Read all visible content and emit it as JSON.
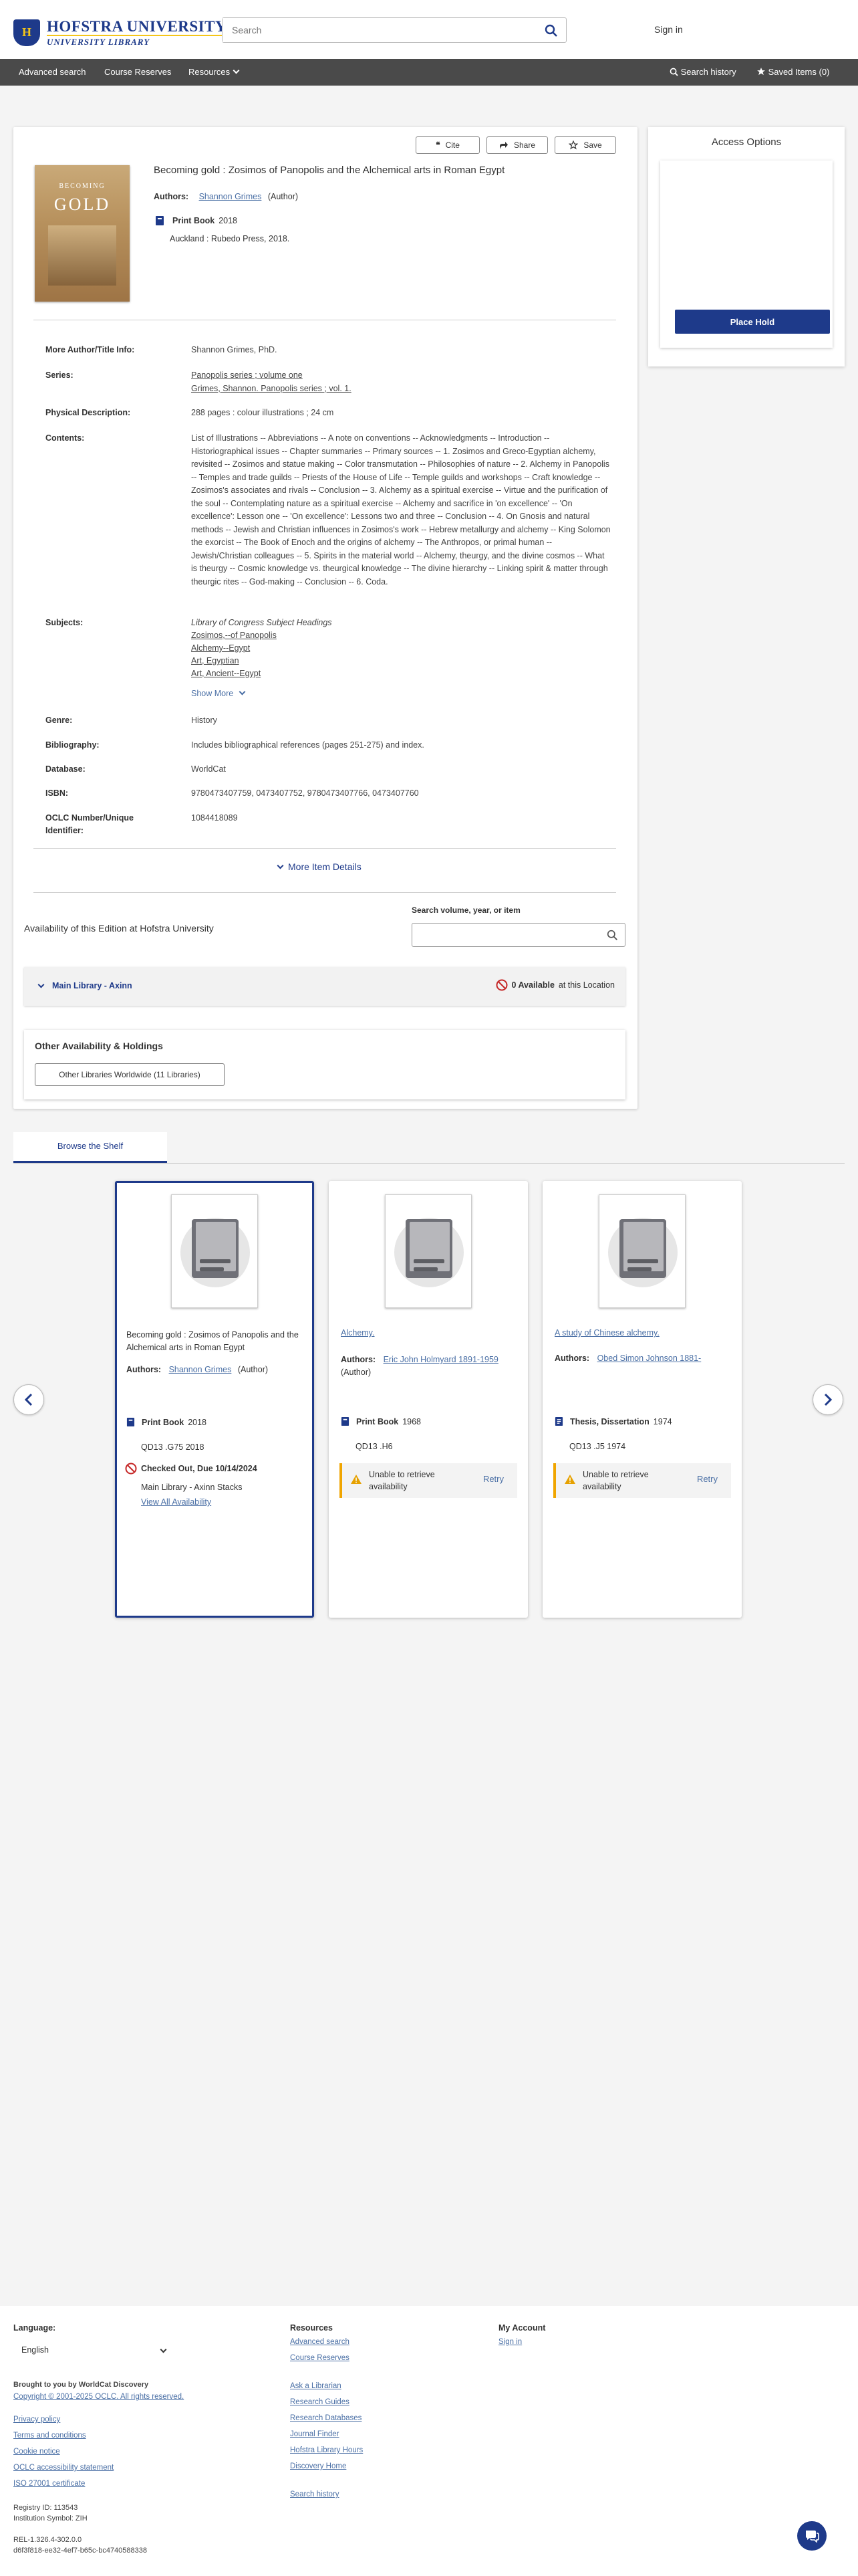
{
  "header": {
    "logo_line1": "HOFSTRA UNIVERSITY.",
    "logo_line2": "UNIVERSITY LIBRARY",
    "search_placeholder": "Search",
    "signin": "Sign in"
  },
  "nav": {
    "advanced_search": "Advanced search",
    "course_reserves": "Course Reserves",
    "resources": "Resources",
    "search_history": "Search history",
    "saved_items": "Saved Items (0)"
  },
  "record": {
    "cite": "Cite",
    "share": "Share",
    "save": "Save",
    "cover_line1": "BECOMING",
    "cover_line2": "GOLD",
    "title": "Becoming gold : Zosimos of Panopolis and the Alchemical arts in Roman Egypt",
    "authors_label": "Authors:",
    "author_name": "Shannon Grimes",
    "author_role": "(Author)",
    "format": "Print Book",
    "year": "2018",
    "publisher": "Auckland : Rubedo Press, 2018."
  },
  "details": {
    "more_author_label": "More Author/Title Info:",
    "more_author_value": "Shannon Grimes, PhD.",
    "series_label": "Series:",
    "series_1": "Panopolis series ; volume one",
    "series_2": "Grimes, Shannon. Panopolis series ; vol. 1.",
    "physical_label": "Physical Description:",
    "physical_value": "288 pages : colour illustrations ; 24 cm",
    "contents_label": "Contents:",
    "contents_value": "List of Illustrations -- Abbreviations -- A note on conventions -- Acknowledgments -- Introduction -- Historiographical issues -- Chapter summaries -- Primary sources -- 1. Zosimos and Greco-Egyptian alchemy, revisited -- Zosimos and statue making -- Color transmutation -- Philosophies of nature -- 2. Alchemy in Panopolis -- Temples and trade guilds -- Priests of the House of Life -- Temple guilds and workshops -- Craft knowledge -- Zosimos's associates and rivals -- Conclusion -- 3. Alchemy as a spiritual exercise -- Virtue and the purification of the soul -- Contemplating nature as a spiritual exercise -- Alchemy and sacrifice in 'on excellence' -- 'On excellence': Lesson one -- 'On excellence': Lessons two and three -- Conclusion -- 4. On Gnosis and natural methods -- Jewish and Christian influences in Zosimos's work -- Hebrew metallurgy and alchemy -- King Solomon the exorcist -- The Book of Enoch and the origins of alchemy -- The Anthropos, or primal human -- Jewish/Christian colleagues -- 5. Spirits in the material world -- Alchemy, theurgy, and the divine cosmos -- What is theurgy -- Cosmic knowledge vs. theurgical knowledge -- The divine hierarchy -- Linking spirit & matter through theurgic rites -- God-making -- Conclusion -- 6. Coda.",
    "subjects_label": "Subjects:",
    "subjects_heading": "Library of Congress Subject Headings",
    "subjects": [
      "Zosimos,--of Panopolis",
      "Alchemy--Egypt",
      "Art, Egyptian",
      "Art, Ancient--Egypt"
    ],
    "show_more": "Show More",
    "genre_label": "Genre:",
    "genre_value": "History",
    "bibliography_label": "Bibliography:",
    "bibliography_value": "Includes bibliographical references (pages 251-275) and index.",
    "database_label": "Database:",
    "database_value": "WorldCat",
    "isbn_label": "ISBN:",
    "isbn_value": "9780473407759, 0473407752, 9780473407766, 0473407760",
    "oclc_label_1": "OCLC Number/Unique",
    "oclc_label_2": "Identifier:",
    "oclc_value": "1084418089",
    "more_item_details": "More Item Details"
  },
  "availability": {
    "heading": "Availability of this Edition at Hofstra University",
    "search_label": "Search volume, year, or item",
    "location": "Main Library - Axinn",
    "available_count": "0 Available",
    "available_suffix": "at this Location",
    "other_heading": "Other Availability & Holdings",
    "other_button": "Other Libraries Worldwide (11 Libraries)"
  },
  "access": {
    "title": "Access Options",
    "place_hold": "Place Hold"
  },
  "shelf": {
    "tab": "Browse the Shelf",
    "cards": [
      {
        "title": "Becoming gold : Zosimos of Panopolis and the Alchemical arts in Roman Egypt",
        "authors_label": "Authors:",
        "author": "Shannon Grimes",
        "role": "(Author)",
        "format": "Print Book",
        "year": "2018",
        "call": "QD13 .G75 2018",
        "status": "Checked Out, Due 10/14/2024",
        "location": "Main Library - Axinn Stacks",
        "view_all": "View All Availability"
      },
      {
        "title": "Alchemy.",
        "authors_label": "Authors:",
        "author": "Eric John Holmyard 1891-1959",
        "role": "(Author)",
        "format": "Print Book",
        "year": "1968",
        "call": "QD13 .H6",
        "warn": "Unable to retrieve availability",
        "retry": "Retry"
      },
      {
        "title": "A study of Chinese alchemy.",
        "authors_label": "Authors:",
        "author": "Obed Simon Johnson 1881-",
        "format": "Thesis, Dissertation",
        "year": "1974",
        "call": "QD13 .J5 1974",
        "warn": "Unable to retrieve availability",
        "retry": "Retry"
      }
    ]
  },
  "footer": {
    "language_label": "Language:",
    "language_value": "English",
    "brought": "Brought to you by WorldCat Discovery",
    "copyright": "Copyright © 2001-2025 OCLC. All rights reserved.",
    "links": [
      "Privacy policy",
      "Terms and conditions",
      "Cookie notice",
      "OCLC accessibility statement",
      "ISO 27001 certificate"
    ],
    "registry": "Registry ID: 113543",
    "institution": "Institution Symbol: ZIH",
    "rel": "REL-1.326.4-302.0.0",
    "hash": "d6f3f818-ee32-4ef7-b65c-bc4740588338",
    "resources_title": "Resources",
    "resources_links": [
      "Advanced search",
      "Course Reserves"
    ],
    "resources_links_2": [
      "Ask a Librarian",
      "Research Guides",
      "Research Databases",
      "Journal Finder",
      "Hofstra Library Hours",
      "Discovery Home"
    ],
    "search_history": "Search history",
    "account_title": "My Account",
    "account_signin": "Sign in"
  },
  "colors": {
    "brand": "#1e3a8a",
    "nav": "#4a4a4a",
    "warning": "#f0a500",
    "unavailable": "#c62828",
    "link": "#4a6fa5"
  }
}
